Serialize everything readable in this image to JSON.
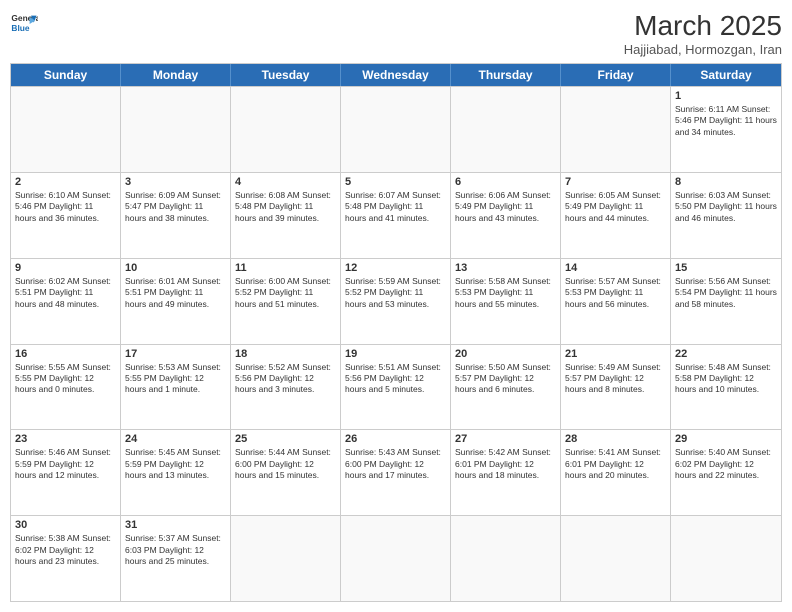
{
  "header": {
    "logo_general": "General",
    "logo_blue": "Blue",
    "month_year": "March 2025",
    "location": "Hajjiabad, Hormozgan, Iran"
  },
  "days_of_week": [
    "Sunday",
    "Monday",
    "Tuesday",
    "Wednesday",
    "Thursday",
    "Friday",
    "Saturday"
  ],
  "weeks": [
    [
      {
        "day": "",
        "info": ""
      },
      {
        "day": "",
        "info": ""
      },
      {
        "day": "",
        "info": ""
      },
      {
        "day": "",
        "info": ""
      },
      {
        "day": "",
        "info": ""
      },
      {
        "day": "",
        "info": ""
      },
      {
        "day": "1",
        "info": "Sunrise: 6:11 AM\nSunset: 5:46 PM\nDaylight: 11 hours and 34 minutes."
      }
    ],
    [
      {
        "day": "2",
        "info": "Sunrise: 6:10 AM\nSunset: 5:46 PM\nDaylight: 11 hours and 36 minutes."
      },
      {
        "day": "3",
        "info": "Sunrise: 6:09 AM\nSunset: 5:47 PM\nDaylight: 11 hours and 38 minutes."
      },
      {
        "day": "4",
        "info": "Sunrise: 6:08 AM\nSunset: 5:48 PM\nDaylight: 11 hours and 39 minutes."
      },
      {
        "day": "5",
        "info": "Sunrise: 6:07 AM\nSunset: 5:48 PM\nDaylight: 11 hours and 41 minutes."
      },
      {
        "day": "6",
        "info": "Sunrise: 6:06 AM\nSunset: 5:49 PM\nDaylight: 11 hours and 43 minutes."
      },
      {
        "day": "7",
        "info": "Sunrise: 6:05 AM\nSunset: 5:49 PM\nDaylight: 11 hours and 44 minutes."
      },
      {
        "day": "8",
        "info": "Sunrise: 6:03 AM\nSunset: 5:50 PM\nDaylight: 11 hours and 46 minutes."
      }
    ],
    [
      {
        "day": "9",
        "info": "Sunrise: 6:02 AM\nSunset: 5:51 PM\nDaylight: 11 hours and 48 minutes."
      },
      {
        "day": "10",
        "info": "Sunrise: 6:01 AM\nSunset: 5:51 PM\nDaylight: 11 hours and 49 minutes."
      },
      {
        "day": "11",
        "info": "Sunrise: 6:00 AM\nSunset: 5:52 PM\nDaylight: 11 hours and 51 minutes."
      },
      {
        "day": "12",
        "info": "Sunrise: 5:59 AM\nSunset: 5:52 PM\nDaylight: 11 hours and 53 minutes."
      },
      {
        "day": "13",
        "info": "Sunrise: 5:58 AM\nSunset: 5:53 PM\nDaylight: 11 hours and 55 minutes."
      },
      {
        "day": "14",
        "info": "Sunrise: 5:57 AM\nSunset: 5:53 PM\nDaylight: 11 hours and 56 minutes."
      },
      {
        "day": "15",
        "info": "Sunrise: 5:56 AM\nSunset: 5:54 PM\nDaylight: 11 hours and 58 minutes."
      }
    ],
    [
      {
        "day": "16",
        "info": "Sunrise: 5:55 AM\nSunset: 5:55 PM\nDaylight: 12 hours and 0 minutes."
      },
      {
        "day": "17",
        "info": "Sunrise: 5:53 AM\nSunset: 5:55 PM\nDaylight: 12 hours and 1 minute."
      },
      {
        "day": "18",
        "info": "Sunrise: 5:52 AM\nSunset: 5:56 PM\nDaylight: 12 hours and 3 minutes."
      },
      {
        "day": "19",
        "info": "Sunrise: 5:51 AM\nSunset: 5:56 PM\nDaylight: 12 hours and 5 minutes."
      },
      {
        "day": "20",
        "info": "Sunrise: 5:50 AM\nSunset: 5:57 PM\nDaylight: 12 hours and 6 minutes."
      },
      {
        "day": "21",
        "info": "Sunrise: 5:49 AM\nSunset: 5:57 PM\nDaylight: 12 hours and 8 minutes."
      },
      {
        "day": "22",
        "info": "Sunrise: 5:48 AM\nSunset: 5:58 PM\nDaylight: 12 hours and 10 minutes."
      }
    ],
    [
      {
        "day": "23",
        "info": "Sunrise: 5:46 AM\nSunset: 5:59 PM\nDaylight: 12 hours and 12 minutes."
      },
      {
        "day": "24",
        "info": "Sunrise: 5:45 AM\nSunset: 5:59 PM\nDaylight: 12 hours and 13 minutes."
      },
      {
        "day": "25",
        "info": "Sunrise: 5:44 AM\nSunset: 6:00 PM\nDaylight: 12 hours and 15 minutes."
      },
      {
        "day": "26",
        "info": "Sunrise: 5:43 AM\nSunset: 6:00 PM\nDaylight: 12 hours and 17 minutes."
      },
      {
        "day": "27",
        "info": "Sunrise: 5:42 AM\nSunset: 6:01 PM\nDaylight: 12 hours and 18 minutes."
      },
      {
        "day": "28",
        "info": "Sunrise: 5:41 AM\nSunset: 6:01 PM\nDaylight: 12 hours and 20 minutes."
      },
      {
        "day": "29",
        "info": "Sunrise: 5:40 AM\nSunset: 6:02 PM\nDaylight: 12 hours and 22 minutes."
      }
    ],
    [
      {
        "day": "30",
        "info": "Sunrise: 5:38 AM\nSunset: 6:02 PM\nDaylight: 12 hours and 23 minutes."
      },
      {
        "day": "31",
        "info": "Sunrise: 5:37 AM\nSunset: 6:03 PM\nDaylight: 12 hours and 25 minutes."
      },
      {
        "day": "",
        "info": ""
      },
      {
        "day": "",
        "info": ""
      },
      {
        "day": "",
        "info": ""
      },
      {
        "day": "",
        "info": ""
      },
      {
        "day": "",
        "info": ""
      }
    ]
  ]
}
